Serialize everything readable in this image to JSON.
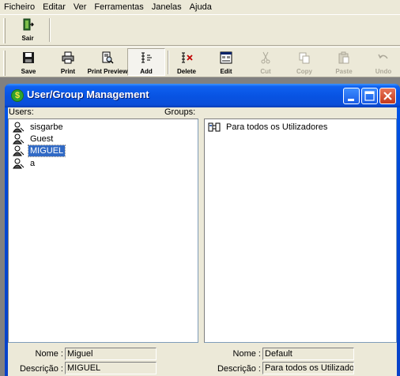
{
  "menu": [
    "Ficheiro",
    "Editar",
    "Ver",
    "Ferramentas",
    "Janelas",
    "Ajuda"
  ],
  "toolbar_exit": {
    "label": "Sair",
    "icon": "exit-door-icon"
  },
  "toolbar": [
    {
      "label": "Save",
      "icon": "floppy-disk-icon",
      "enabled": true
    },
    {
      "label": "Print",
      "icon": "printer-icon",
      "enabled": true
    },
    {
      "label": "Print Preview",
      "icon": "print-preview-icon",
      "enabled": true
    },
    {
      "label": "Add",
      "icon": "add-icon",
      "enabled": true,
      "pressed": true
    },
    {
      "label": "Delete",
      "icon": "delete-icon",
      "enabled": true
    },
    {
      "label": "Edit",
      "icon": "edit-icon",
      "enabled": true
    },
    {
      "label": "Cut",
      "icon": "scissors-icon",
      "enabled": false
    },
    {
      "label": "Copy",
      "icon": "copy-icon",
      "enabled": false
    },
    {
      "label": "Paste",
      "icon": "paste-icon",
      "enabled": false
    },
    {
      "label": "Undo",
      "icon": "undo-icon",
      "enabled": false
    }
  ],
  "window": {
    "title": "User/Group Management",
    "users_label": "Users:",
    "groups_label": "Groups:",
    "users": [
      {
        "name": "sisgarbe",
        "selected": false
      },
      {
        "name": "Guest",
        "selected": false
      },
      {
        "name": "MIGUEL",
        "selected": true
      },
      {
        "name": "a",
        "selected": false
      }
    ],
    "groups": [
      {
        "name": "Para todos os Utilizadores"
      }
    ],
    "user_details": {
      "name_label": "Nome :",
      "name_value": "Miguel",
      "desc_label": "Descrição :",
      "desc_value": "MIGUEL"
    },
    "group_details": {
      "name_label": "Nome :",
      "name_value": "Default",
      "desc_label": "Descrição :",
      "desc_value": "Para todos os Utilizadores"
    }
  },
  "colors": {
    "face": "#ECE9D8",
    "selection": "#316AC5",
    "titlebar": "#0A4ED9",
    "mdi_background": "#808080"
  }
}
